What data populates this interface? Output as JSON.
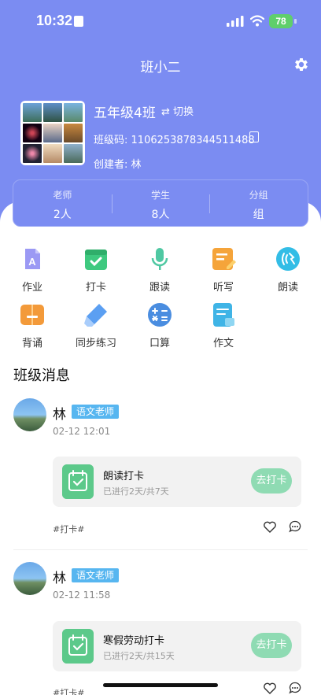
{
  "status": {
    "time": "10:32",
    "battery": "78"
  },
  "nav": {
    "title": "班小二"
  },
  "class": {
    "name": "五年级4班",
    "switch_label": "⇄ 切换",
    "code_label": "班级码:",
    "code": "1106253878344511488",
    "creator_label": "创建者:",
    "creator": "林"
  },
  "stats": [
    {
      "label": "老师",
      "value": "2人"
    },
    {
      "label": "学生",
      "value": "8人"
    },
    {
      "label": "分组",
      "value": "组"
    }
  ],
  "features": [
    {
      "label": "作业",
      "icon": "homework-icon",
      "color": "#8e8cf0"
    },
    {
      "label": "打卡",
      "icon": "checkin-icon",
      "color": "#3ec97f"
    },
    {
      "label": "跟读",
      "icon": "microphone-icon",
      "color": "#4fc8a2"
    },
    {
      "label": "听写",
      "icon": "dictation-icon",
      "color": "#f5a43a"
    },
    {
      "label": "朗读",
      "icon": "reading-aloud-icon",
      "color": "#33bde6"
    },
    {
      "label": "背诵",
      "icon": "recite-icon",
      "color": "#f39a3a"
    },
    {
      "label": "同步练习",
      "icon": "eraser-icon",
      "color": "#5b9ff2"
    },
    {
      "label": "口算",
      "icon": "calculator-icon",
      "color": "#4a8de0"
    },
    {
      "label": "作文",
      "icon": "composition-icon",
      "color": "#3fb4e6"
    }
  ],
  "messages": {
    "title": "班级消息",
    "items": [
      {
        "poster": "林",
        "role": "语文老师",
        "time": "02-12 12:01",
        "task": "朗读打卡",
        "progress": "已进行2天/共7天",
        "action": "去打卡",
        "tag": "#打卡#"
      },
      {
        "poster": "林",
        "role": "语文老师",
        "time": "02-12 11:58",
        "task": "寒假劳动打卡",
        "progress": "已进行2天/共15天",
        "action": "去打卡",
        "tag": "#打卡#"
      }
    ]
  }
}
